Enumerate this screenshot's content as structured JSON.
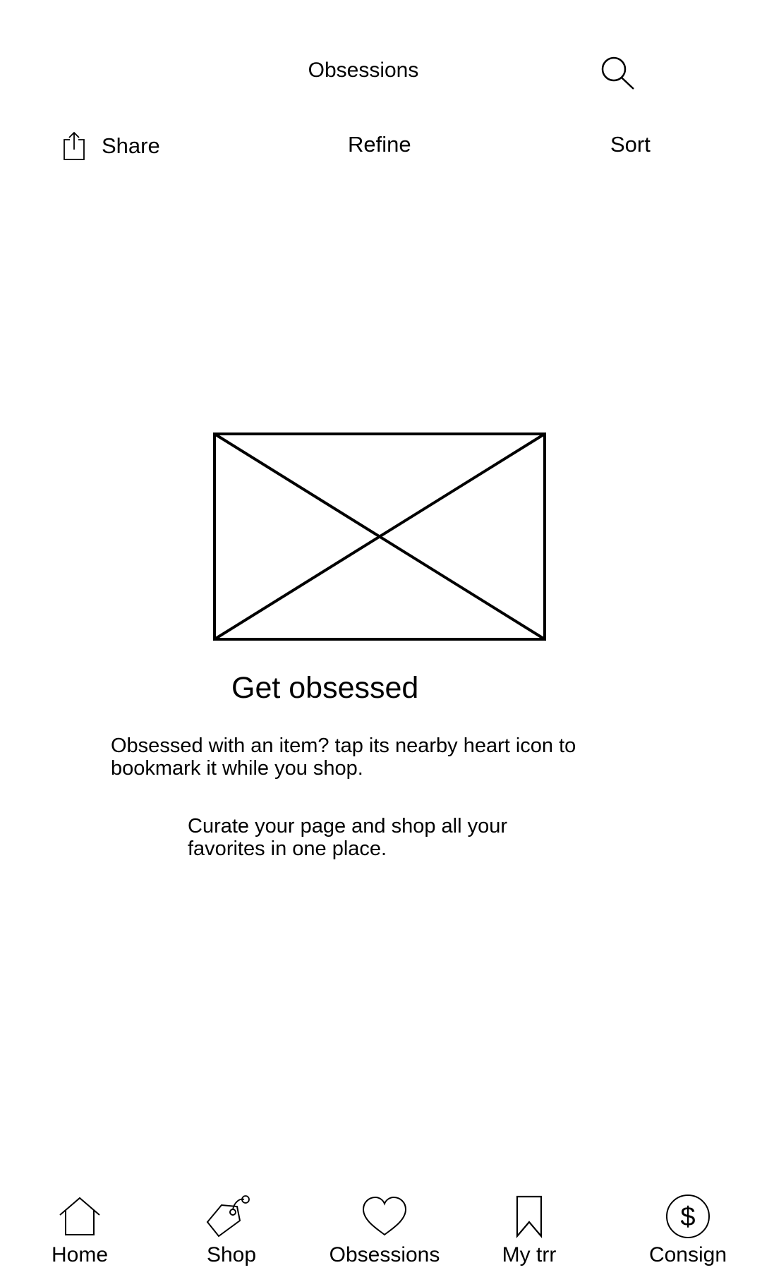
{
  "header": {
    "title": "Obsessions",
    "search_icon": "search-icon"
  },
  "toolbar": {
    "share_label": "Share",
    "share_icon": "share-icon",
    "refine_label": "Refine",
    "sort_label": "Sort"
  },
  "empty_state": {
    "image": "image-placeholder",
    "title": "Get obsessed",
    "line1": "Obsessed with an item? tap its nearby heart icon to bookmark it while you shop.",
    "line2": "Curate your page and shop all your favorites in one place."
  },
  "bottom_nav": {
    "items": [
      {
        "label": "Home",
        "icon": "home-icon"
      },
      {
        "label": "Shop",
        "icon": "tag-icon"
      },
      {
        "label": "Obsessions",
        "icon": "heart-icon"
      },
      {
        "label": "My trr",
        "icon": "bookmark-icon"
      },
      {
        "label": "Consign",
        "icon": "dollar-icon"
      }
    ]
  }
}
